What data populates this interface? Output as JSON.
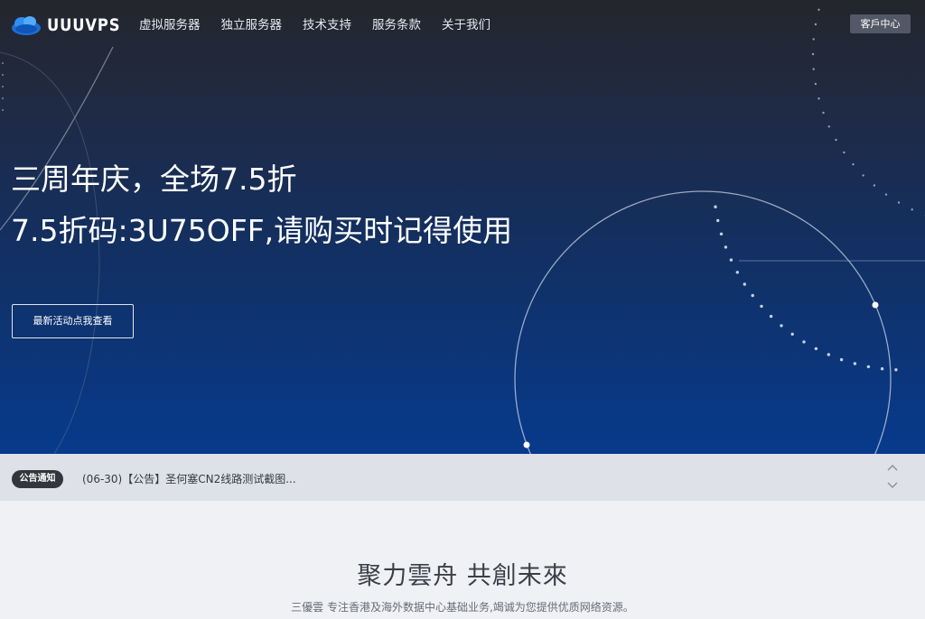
{
  "brand": {
    "name": "UUUVPS",
    "logo_icon": "cloud-logo-icon"
  },
  "nav": {
    "items": [
      "虚拟服务器",
      "独立服务器",
      "技术支持",
      "服务条款",
      "关于我们"
    ],
    "client_center": "客戶中心"
  },
  "hero": {
    "headline1": "三周年庆，全场7.5折",
    "headline2": "7.5折码:3U75OFF,请购买时记得使用",
    "button": "最新活动点我查看"
  },
  "notice": {
    "badge": "公告通知",
    "text": "(06-30)【公告】圣何塞CN2线路测试截图...",
    "up_icon": "chevron-up-icon",
    "down_icon": "chevron-down-icon"
  },
  "section": {
    "title": "聚力雲舟 共創未來",
    "subtitle": "三優雲 专注香港及海外数据中心基础业务,竭诚为您提供优质网络资源。"
  },
  "colors": {
    "hero_top": "#24262d",
    "hero_bottom": "#073a8c",
    "notice_bg": "#dfe1e8",
    "page_bg": "#f0f1f5"
  }
}
